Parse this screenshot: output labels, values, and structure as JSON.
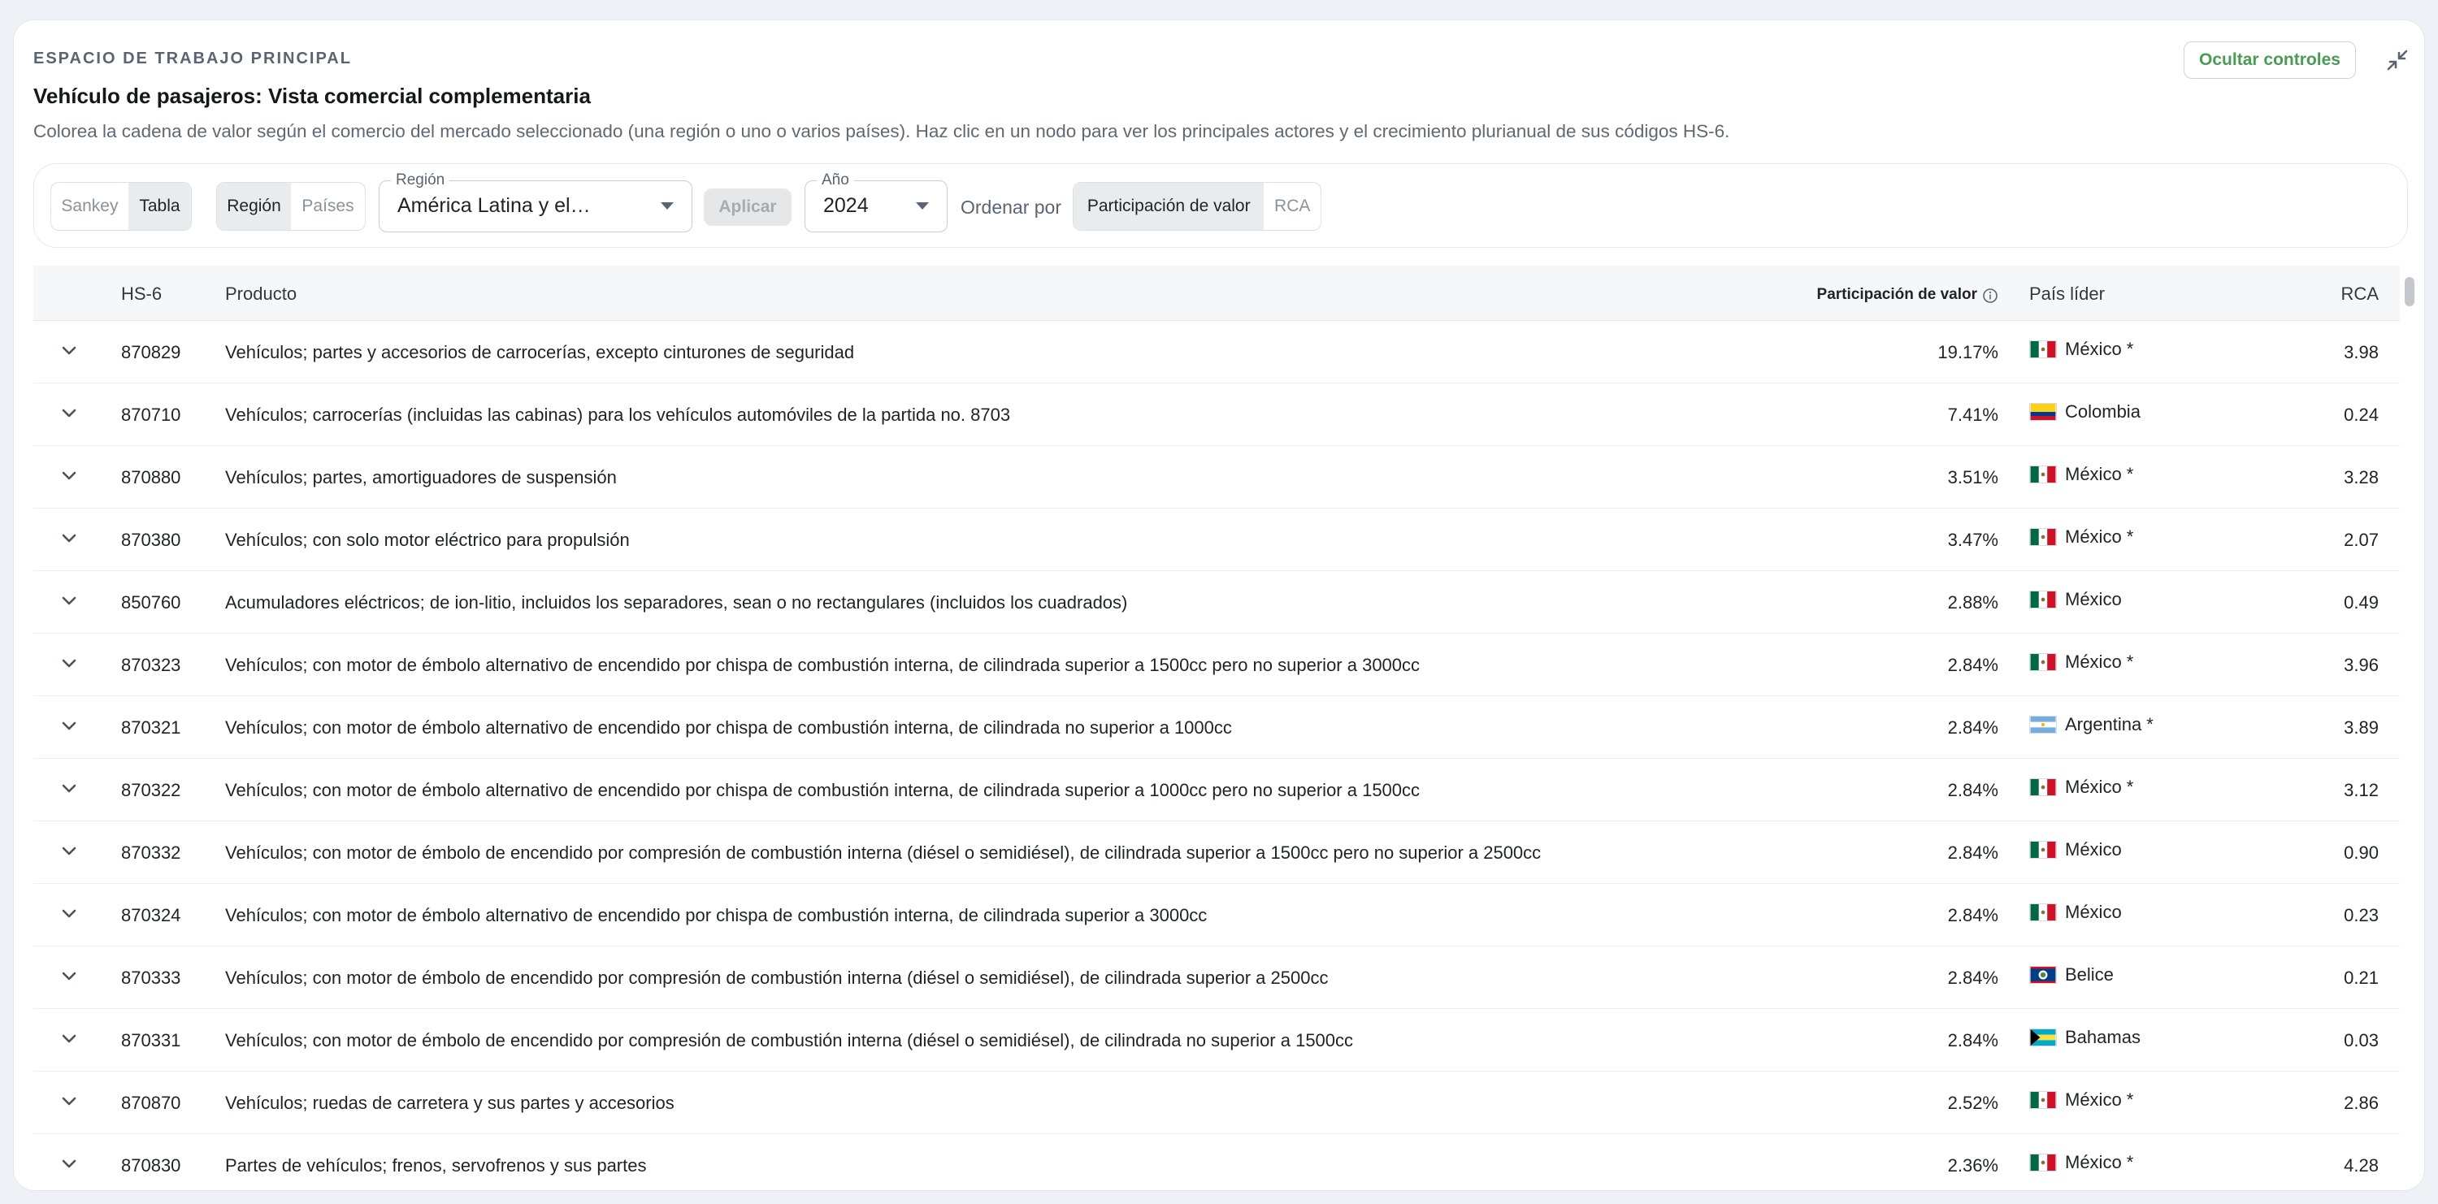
{
  "header": {
    "eyebrow": "ESPACIO DE TRABAJO PRINCIPAL",
    "title": "Vehículo de pasajeros: Vista comercial complementaria",
    "subtitle": "Colorea la cadena de valor según el comercio del mercado seleccionado (una región o uno o varios países). Haz clic en un nodo para ver los principales actores y el crecimiento plurianual de sus códigos HS-6.",
    "hide_controls_label": "Ocultar controles"
  },
  "toolbar": {
    "view_options": [
      "Sankey",
      "Tabla"
    ],
    "view_selected": "Tabla",
    "scope_options": [
      "Región",
      "Países"
    ],
    "scope_selected": "Región",
    "region_label": "Región",
    "region_value": "América Latina y el…",
    "apply_label": "Aplicar",
    "year_label": "Año",
    "year_value": "2024",
    "sort_label": "Ordenar por",
    "sort_options": [
      "Participación de valor",
      "RCA"
    ],
    "sort_selected": "Participación de valor"
  },
  "table": {
    "columns": {
      "hs6": "HS-6",
      "product": "Producto",
      "share": "Participación de valor",
      "leader": "País líder",
      "rca": "RCA"
    },
    "rows": [
      {
        "hs6": "870829",
        "product": "Vehículos; partes y accesorios de carrocerías, excepto cinturones de seguridad",
        "share": "19.17%",
        "leader": "México *",
        "flag": "mx",
        "rca": "3.98"
      },
      {
        "hs6": "870710",
        "product": "Vehículos; carrocerías (incluidas las cabinas) para los vehículos automóviles de la partida no. 8703",
        "share": "7.41%",
        "leader": "Colombia",
        "flag": "co",
        "rca": "0.24"
      },
      {
        "hs6": "870880",
        "product": "Vehículos; partes, amortiguadores de suspensión",
        "share": "3.51%",
        "leader": "México *",
        "flag": "mx",
        "rca": "3.28"
      },
      {
        "hs6": "870380",
        "product": "Vehículos; con solo motor eléctrico para propulsión",
        "share": "3.47%",
        "leader": "México *",
        "flag": "mx",
        "rca": "2.07"
      },
      {
        "hs6": "850760",
        "product": "Acumuladores eléctricos; de ion-litio, incluidos los separadores, sean o no rectangulares (incluidos los cuadrados)",
        "share": "2.88%",
        "leader": "México",
        "flag": "mx",
        "rca": "0.49"
      },
      {
        "hs6": "870323",
        "product": "Vehículos; con motor de émbolo alternativo de encendido por chispa de combustión interna, de cilindrada superior a 1500cc pero no superior a 3000cc",
        "share": "2.84%",
        "leader": "México *",
        "flag": "mx",
        "rca": "3.96"
      },
      {
        "hs6": "870321",
        "product": "Vehículos; con motor de émbolo alternativo de encendido por chispa de combustión interna, de cilindrada no superior a 1000cc",
        "share": "2.84%",
        "leader": "Argentina *",
        "flag": "ar",
        "rca": "3.89"
      },
      {
        "hs6": "870322",
        "product": "Vehículos; con motor de émbolo alternativo de encendido por chispa de combustión interna, de cilindrada superior a 1000cc pero no superior a 1500cc",
        "share": "2.84%",
        "leader": "México *",
        "flag": "mx",
        "rca": "3.12"
      },
      {
        "hs6": "870332",
        "product": "Vehículos; con motor de émbolo de encendido por compresión de combustión interna (diésel o semidiésel), de cilindrada superior a 1500cc pero no superior a 2500cc",
        "share": "2.84%",
        "leader": "México",
        "flag": "mx",
        "rca": "0.90"
      },
      {
        "hs6": "870324",
        "product": "Vehículos; con motor de émbolo alternativo de encendido por chispa de combustión interna, de cilindrada superior a 3000cc",
        "share": "2.84%",
        "leader": "México",
        "flag": "mx",
        "rca": "0.23"
      },
      {
        "hs6": "870333",
        "product": "Vehículos; con motor de émbolo de encendido por compresión de combustión interna (diésel o semidiésel), de cilindrada superior a 2500cc",
        "share": "2.84%",
        "leader": "Belice",
        "flag": "bz",
        "rca": "0.21"
      },
      {
        "hs6": "870331",
        "product": "Vehículos; con motor de émbolo de encendido por compresión de combustión interna (diésel o semidiésel), de cilindrada no superior a 1500cc",
        "share": "2.84%",
        "leader": "Bahamas",
        "flag": "bs",
        "rca": "0.03"
      },
      {
        "hs6": "870870",
        "product": "Vehículos; ruedas de carretera y sus partes y accesorios",
        "share": "2.52%",
        "leader": "México *",
        "flag": "mx",
        "rca": "2.86"
      },
      {
        "hs6": "870830",
        "product": "Partes de vehículos; frenos, servofrenos y sus partes",
        "share": "2.36%",
        "leader": "México *",
        "flag": "mx",
        "rca": "4.28"
      }
    ]
  },
  "colors": {
    "accent_green": "#4a9b54",
    "header_bg": "#f6f7f9",
    "active_seg": "#e9ecef"
  }
}
